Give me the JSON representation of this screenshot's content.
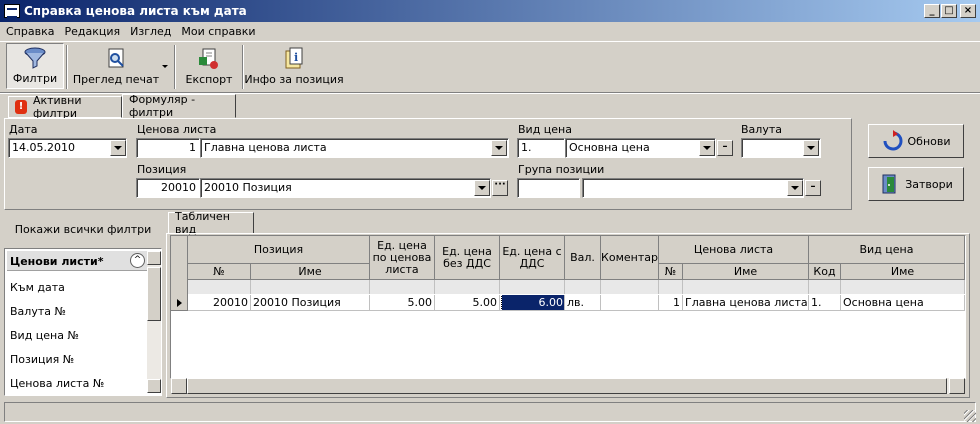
{
  "window": {
    "title": "Справка ценова листа към дата",
    "min": "_",
    "max": "□",
    "close": "×"
  },
  "menu": [
    "Справка",
    "Редакция",
    "Изглед",
    "Мои справки"
  ],
  "toolbar": {
    "filters": "Филтри",
    "preview": "Преглед печат",
    "export": "Експорт",
    "info": "Инфо за позиция"
  },
  "tabs": {
    "active_filters": "Активни филтри",
    "form": "Формуляр - филтри",
    "table_view": "Табличен вид"
  },
  "form": {
    "date_label": "Дата",
    "date_value": "14.05.2010",
    "pricelist_label": "Ценова листа",
    "pricelist_no": "1",
    "pricelist_name": "Главна ценова листа",
    "pricetype_label": "Вид цена",
    "pricetype_no": "1.",
    "pricetype_name": "Основна цена",
    "currency_label": "Валута",
    "currency_value": "",
    "position_label": "Позиция",
    "position_no": "20010",
    "position_name": "20010 Позиция",
    "group_label": "Група позиции",
    "group_no": "",
    "group_name": ""
  },
  "buttons": {
    "refresh": "Обнови",
    "close": "Затвори",
    "show_all_filters": "Покажи всички филтри"
  },
  "filters_list": {
    "header": "Ценови листи*",
    "items": [
      "Към дата",
      "Валута №",
      "Вид цена №",
      "Позиция №",
      "Ценова листа №"
    ]
  },
  "grid": {
    "headers": {
      "position": "Позиция",
      "no": "№",
      "name": "Име",
      "unit_price_list": "Ед. цена по ценова листа",
      "unit_no_vat": "Ед. цена без ДДС",
      "unit_with_vat": "Ед. цена с ДДС",
      "currency": "Вал.",
      "comment": "Коментар",
      "pricelist": "Ценова листа",
      "pl_no": "№",
      "pl_name": "Име",
      "pricetype": "Вид цена",
      "pt_code": "Код",
      "pt_name": "Име"
    },
    "row": {
      "no": "20010",
      "name": "20010 Позиция",
      "price_list": "5.00",
      "no_vat": "5.00",
      "with_vat": "6.00",
      "currency": "лв.",
      "comment": "",
      "pl_no": "1",
      "pl_name": "Главна ценова листа",
      "pt_code": "1.",
      "pt_name": "Основна цена"
    }
  },
  "colors": {
    "titlebar": "#0a246a",
    "accent": "#0a246a",
    "window": "#d4d0c8"
  }
}
